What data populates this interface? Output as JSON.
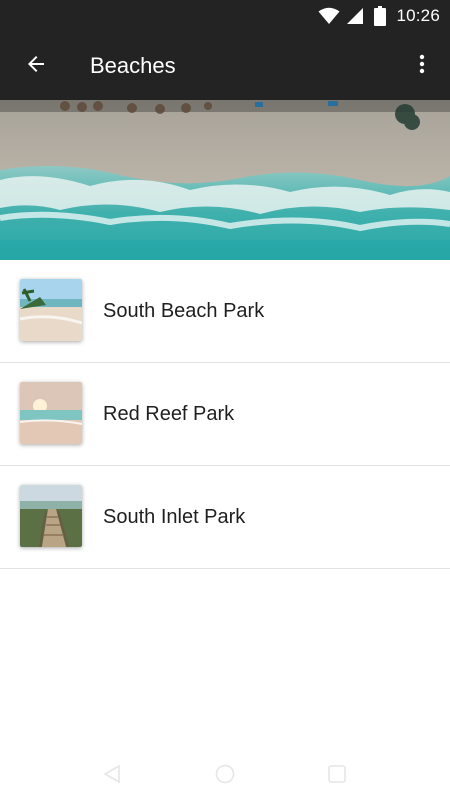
{
  "status_bar": {
    "time": "10:26",
    "icons": [
      "wifi-icon",
      "cell-signal-icon",
      "battery-icon"
    ]
  },
  "app_bar": {
    "title": "Beaches",
    "back_icon": "arrow-left-icon",
    "menu_icon": "more-vert-icon"
  },
  "hero": {
    "image": "aerial-beach-waves"
  },
  "beaches": [
    {
      "name": "South Beach Park",
      "thumbnail": "palm-beach-thumbnail"
    },
    {
      "name": "Red Reef Park",
      "thumbnail": "sunset-beach-thumbnail"
    },
    {
      "name": "South Inlet Park",
      "thumbnail": "boardwalk-thumbnail"
    }
  ],
  "nav_bar": {
    "icons": [
      "back-triangle-icon",
      "home-circle-icon",
      "recents-square-icon"
    ]
  },
  "colors": {
    "app_bar": "#232323",
    "divider": "#e2e2e2",
    "text": "#1f1f1f"
  }
}
